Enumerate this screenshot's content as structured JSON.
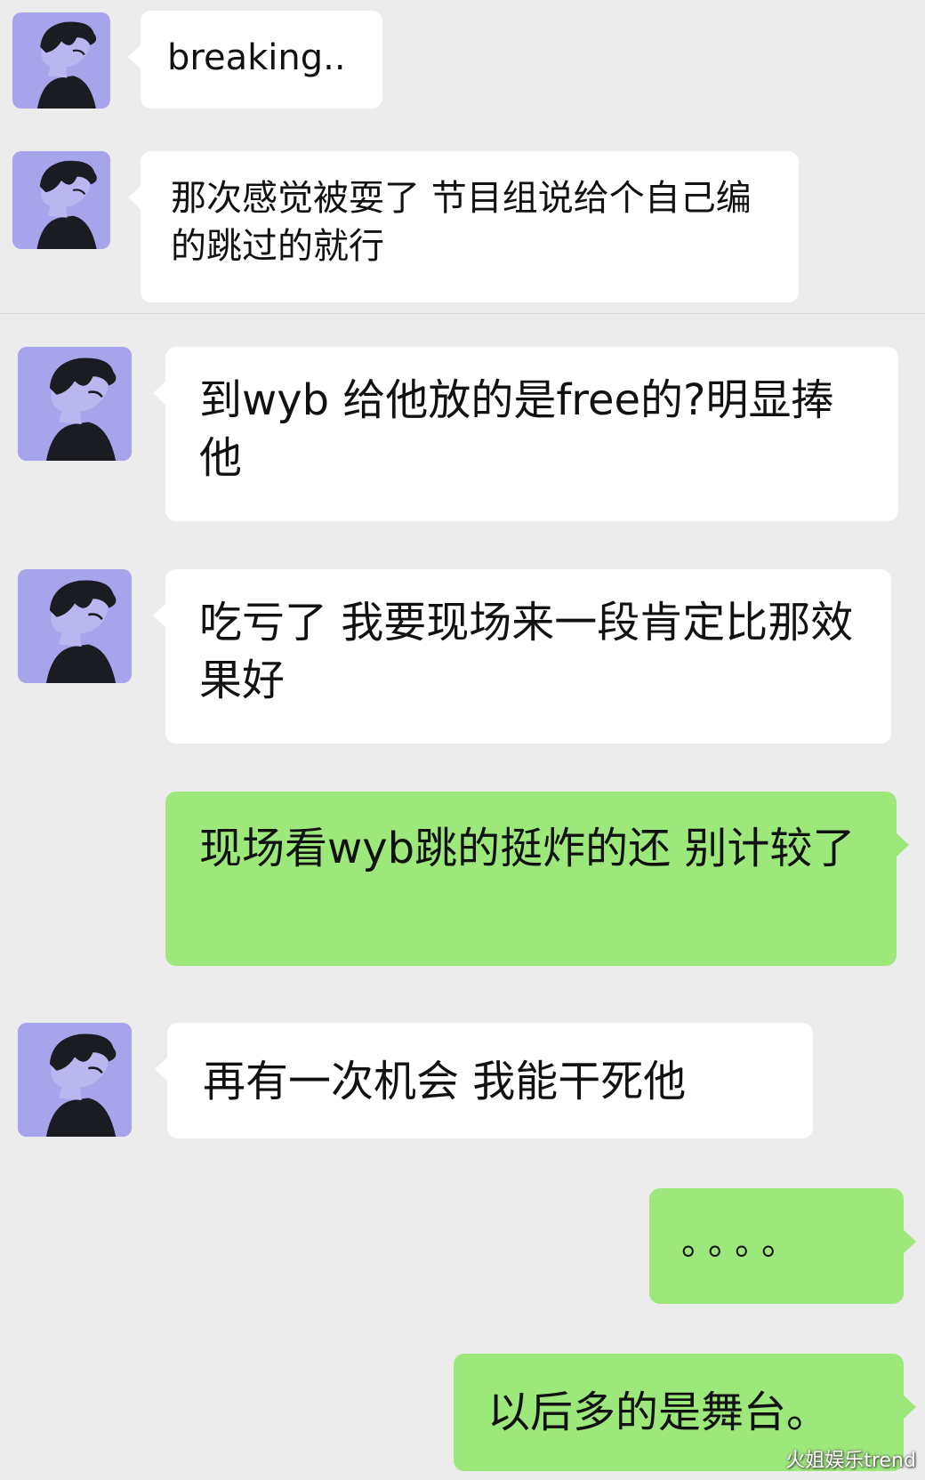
{
  "messages": [
    {
      "sender": "contact",
      "text": "breaking.."
    },
    {
      "sender": "contact",
      "text": "那次感觉被耍了 节目组说给个自己编的跳过的就行"
    },
    {
      "sender": "contact",
      "text": "到wyb 给他放的是free的?明显捧他"
    },
    {
      "sender": "contact",
      "text": "吃亏了  我要现场来一段肯定比那效果好"
    },
    {
      "sender": "me",
      "text": "现场看wyb跳的挺炸的还  别计较了"
    },
    {
      "sender": "contact",
      "text": "再有一次机会   我能干死他"
    },
    {
      "sender": "me",
      "text": "。。。。"
    },
    {
      "sender": "me",
      "text": "以后多的是舞台。"
    }
  ],
  "avatar_icon": "user-avatar-profile-illustration",
  "watermark": "火姐娱乐trend",
  "colors": {
    "background": "#ececec",
    "incoming_bubble": "#ffffff",
    "outgoing_bubble": "#9de87a",
    "avatar_bg": "#a7a4ec"
  }
}
